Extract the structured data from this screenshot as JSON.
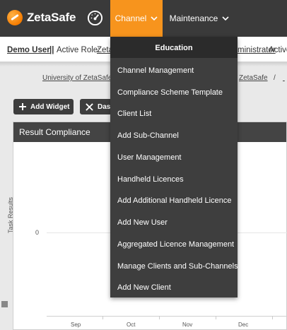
{
  "navbar": {
    "logo_text": "ZetaSafe",
    "channel_label": "Channel",
    "maintenance_label": "Maintenance"
  },
  "rolebar": {
    "user": "Demo User",
    "sep": "||",
    "active_role_label": "Active Role:",
    "active_role_value": "Zeta",
    "admin_fragment": "ministrator",
    "active_tail": "Active"
  },
  "breadcrumb": {
    "left": "University of ZetaSafe",
    "right": "ZetaSafe",
    "sep": "/"
  },
  "buttons": {
    "add_widget": "Add Widget",
    "dashboard_fragment": "Das"
  },
  "widget": {
    "title": "Result Compliance"
  },
  "chart_data": {
    "type": "bar",
    "ylabel": "Task Results",
    "yticks": [
      "0"
    ],
    "categories": [
      "Sep",
      "Oct",
      "Nov",
      "Dec"
    ],
    "values": []
  },
  "dropdown": {
    "header": "Education",
    "items": [
      "Channel Management",
      "Compliance Scheme Template",
      "Client List",
      "Add Sub-Channel",
      "User Management",
      "Handheld Licences",
      "Add Additional Handheld Licence",
      "Add New User",
      "Aggregated Licence Management",
      "Manage Clients and Sub-Channels",
      "Add New Client"
    ]
  }
}
